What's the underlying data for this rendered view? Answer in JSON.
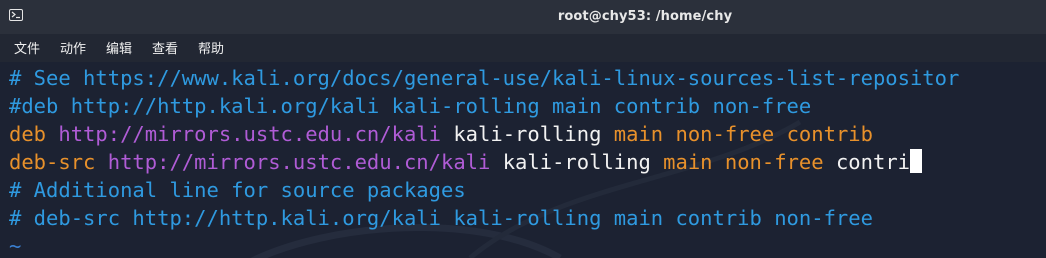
{
  "window": {
    "title": "root@chy53: /home/chy",
    "icon": "terminal-icon"
  },
  "menu": [
    "文件",
    "动作",
    "编辑",
    "查看",
    "帮助"
  ],
  "terminal": {
    "lines": [
      {
        "type": "comment",
        "text": "# See https://www.kali.org/docs/general-use/kali-linux-sources-list-repositor"
      },
      {
        "type": "comment",
        "text": "#deb http://http.kali.org/kali kali-rolling main contrib non-free"
      },
      {
        "type": "code",
        "keyword": "deb",
        "url": "http://mirrors.ustc.edu.cn/kali",
        "suite": "kali-rolling",
        "components": "main non-free contrib"
      },
      {
        "type": "code",
        "keyword": "deb-src",
        "url": "http://mirrors.ustc.edu.cn/kali",
        "suite": "kali-rolling",
        "components": "main non-free",
        "tail": "contri"
      },
      {
        "type": "comment",
        "text": "# Additional line for source packages"
      },
      {
        "type": "comment",
        "text": "# deb-src http://http.kali.org/kali kali-rolling main contrib non-free"
      },
      {
        "type": "tilde",
        "text": "~"
      }
    ]
  },
  "colors": {
    "comment": "#2f9ae0",
    "keyword": "#e8912b",
    "url": "#b05cd6",
    "text": "#f2f2f2",
    "background": "#1c2232"
  }
}
